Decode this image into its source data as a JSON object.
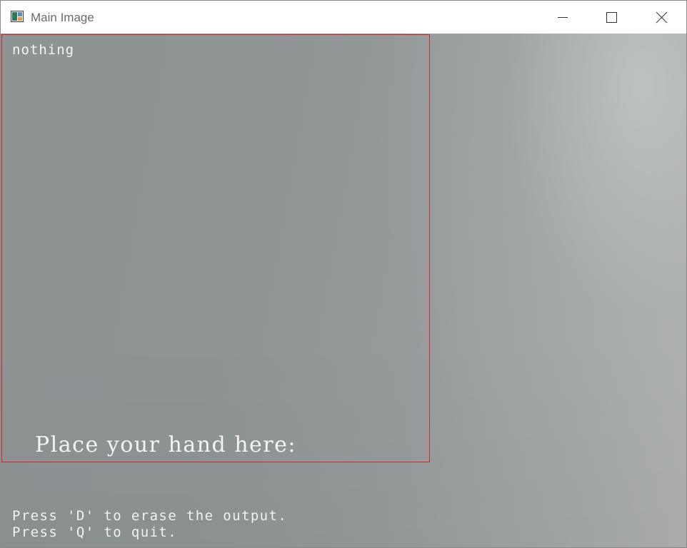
{
  "window": {
    "title": "Main Image",
    "controls": {
      "minimize_icon": "minimize-icon",
      "maximize_icon": "maximize-icon",
      "close_icon": "close-icon"
    }
  },
  "overlay": {
    "prediction": "nothing",
    "roi_prompt": "Place your hand here:",
    "roi_color": "#d6262b",
    "instructions": [
      "Press 'D' to erase the output.",
      "Press 'Q' to quit."
    ]
  }
}
